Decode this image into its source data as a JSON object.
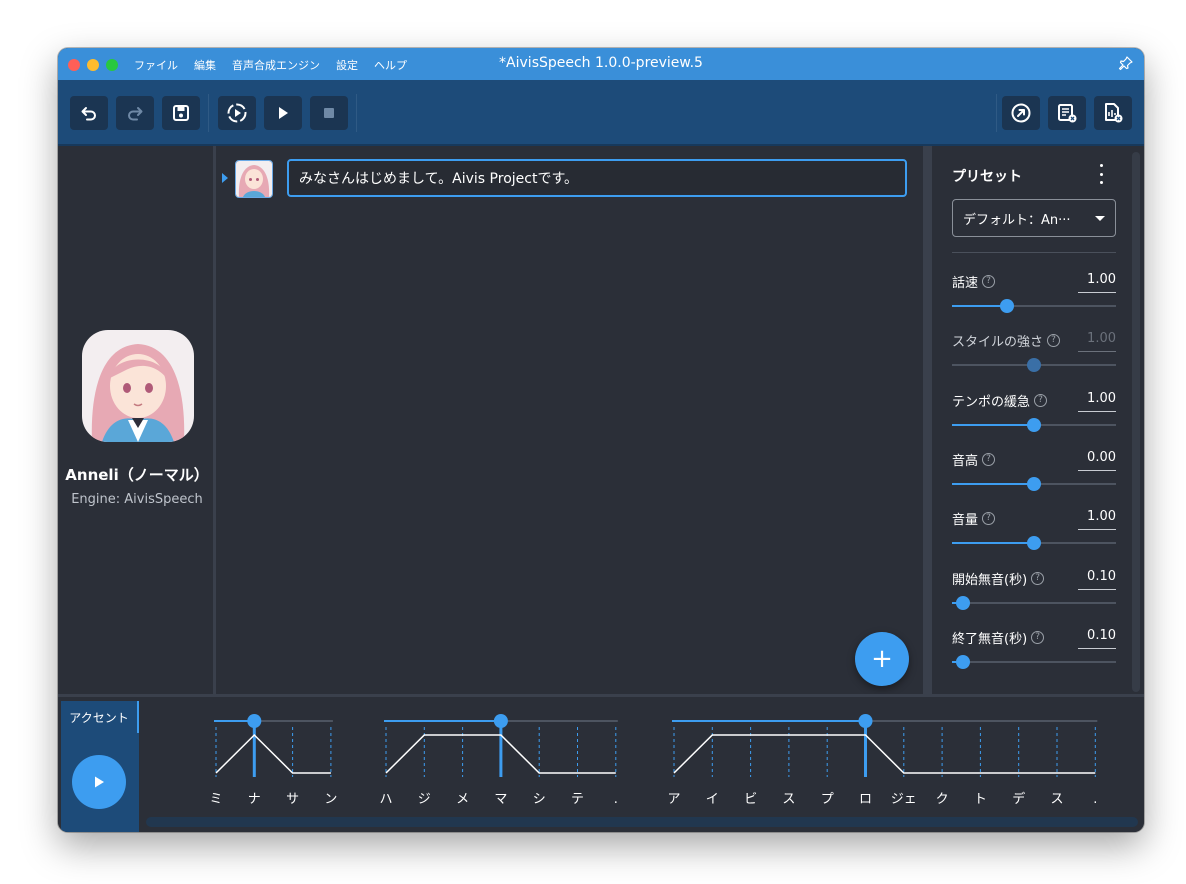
{
  "window": {
    "title": "*AivisSpeech 1.0.0-preview.5"
  },
  "menu": [
    "ファイル",
    "編集",
    "音声合成エンジン",
    "設定",
    "ヘルプ"
  ],
  "toolbar": {
    "left_icons": [
      "undo-icon",
      "redo-icon",
      "save-icon",
      "continuous-play-icon",
      "play-icon",
      "stop-icon"
    ],
    "right_icons": [
      "export-icon",
      "export-text-icon",
      "export-audio-icon"
    ]
  },
  "character": {
    "name": "Anneli（ノーマル）",
    "engine": "Engine: AivisSpeech"
  },
  "editor": {
    "text": "みなさんはじめまして。Aivis Projectです。",
    "add_label": "+"
  },
  "preset": {
    "title": "プリセット",
    "selected": "デフォルト：An···",
    "params": [
      {
        "label": "話速",
        "value": "1.00",
        "level": 0.333,
        "disabled": false
      },
      {
        "label": "スタイルの強さ",
        "value": "1.00",
        "level": 0.5,
        "disabled": true
      },
      {
        "label": "テンポの緩急",
        "value": "1.00",
        "level": 0.5,
        "disabled": false
      },
      {
        "label": "音高",
        "value": "0.00",
        "level": 0.5,
        "disabled": false
      },
      {
        "label": "音量",
        "value": "1.00",
        "level": 0.5,
        "disabled": false
      },
      {
        "label": "開始無音(秒)",
        "value": "0.10",
        "level": 0.067,
        "disabled": false
      },
      {
        "label": "終了無音(秒)",
        "value": "0.10",
        "level": 0.067,
        "disabled": false
      }
    ]
  },
  "accent": {
    "tab_label": "アクセント",
    "phrases": [
      {
        "moras": [
          "ミ",
          "ナ",
          "サ",
          "ン"
        ],
        "accent": 2
      },
      {
        "moras": [
          "ハ",
          "ジ",
          "メ",
          "マ",
          "シ",
          "テ",
          "."
        ],
        "accent": 4
      },
      {
        "moras": [
          "ア",
          "イ",
          "ビ",
          "ス",
          "プ",
          "ロ",
          "ジェ",
          "ク",
          "ト",
          "デ",
          "ス",
          "."
        ],
        "accent": 6
      }
    ]
  }
}
